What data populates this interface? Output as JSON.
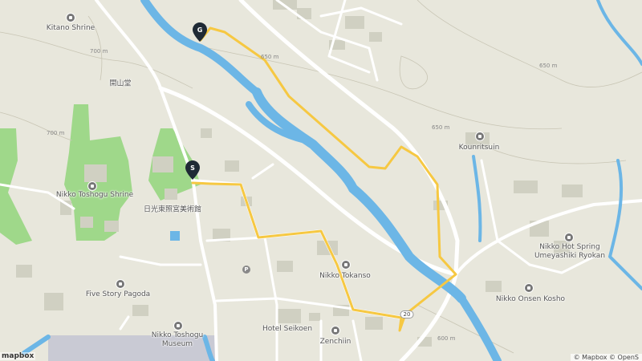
{
  "map": {
    "places": [
      {
        "id": "kitano-shrine",
        "label": "Kitano Shrine"
      },
      {
        "id": "kaisando",
        "label": "開山堂"
      },
      {
        "id": "nikko-toshogu-shrine",
        "label": "Nikko Toshogu Shrine"
      },
      {
        "id": "toshogu-museum-jp",
        "label": "日光東照宮美術館"
      },
      {
        "id": "five-story-pagoda",
        "label": "Five Story Pagoda"
      },
      {
        "id": "nikko-toshogu-museum",
        "label": "Nikko Toshogu\nMuseum"
      },
      {
        "id": "nikko-tokanso",
        "label": "Nikko Tokanso"
      },
      {
        "id": "hotel-seikoen",
        "label": "Hotel Seikoen"
      },
      {
        "id": "zenchiin",
        "label": "Zenchiin"
      },
      {
        "id": "kounritsuin",
        "label": "Kounritsuin"
      },
      {
        "id": "umeyashiki",
        "label": "Nikko Hot Spring\nUmeyashiki Ryokan"
      },
      {
        "id": "onsen-kosho",
        "label": "Nikko Onsen Kosho"
      }
    ],
    "contours": [
      "700 m",
      "700 m",
      "650 m",
      "650 m",
      "650 m",
      "600 m"
    ],
    "road_shield": "20",
    "markers": {
      "start": "S",
      "goal": "G"
    },
    "parking_symbol": "P",
    "attribution": "© Mapbox © OpenS",
    "logo": "mapbox"
  },
  "colors": {
    "land": "#e8e7dc",
    "park": "#9fd88a",
    "water": "#6cb6e6",
    "road": "#ffffff",
    "route": "#f6c842",
    "building": "#d4d4c8"
  }
}
